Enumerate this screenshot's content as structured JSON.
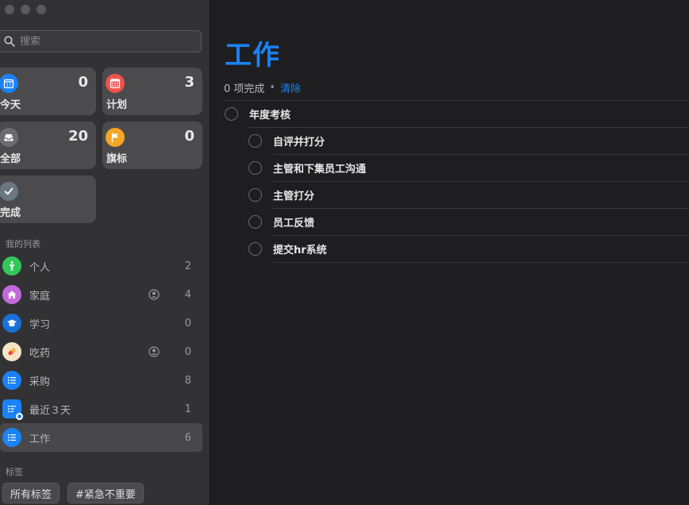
{
  "window": {
    "controls": [
      "close",
      "minimize",
      "zoom"
    ]
  },
  "sidebar": {
    "search": {
      "placeholder": "搜索"
    },
    "smart_lists": [
      {
        "id": "today",
        "label": "今天",
        "count": "0",
        "icon": "calendar-icon",
        "color": "#1a82f7"
      },
      {
        "id": "scheduled",
        "label": "计划",
        "count": "3",
        "icon": "calendar-grid-icon",
        "color": "#f0524c"
      },
      {
        "id": "all",
        "label": "全部",
        "count": "20",
        "icon": "tray-icon",
        "color": "#6c6c70"
      },
      {
        "id": "flagged",
        "label": "旗标",
        "count": "0",
        "icon": "flag-icon",
        "color": "#f5a623"
      },
      {
        "id": "completed",
        "label": "完成",
        "count": "",
        "icon": "checkmark-icon",
        "color": "#6c7780"
      }
    ],
    "my_lists_label": "我的列表",
    "lists": [
      {
        "label": "个人",
        "count": "2",
        "shared": false,
        "icon": "person-icon",
        "color": "#33c759"
      },
      {
        "label": "家庭",
        "count": "4",
        "shared": true,
        "icon": "house-icon",
        "color": "#c26adb"
      },
      {
        "label": "学习",
        "count": "0",
        "shared": false,
        "icon": "graduation-cap-icon",
        "color": "#1a6fd8"
      },
      {
        "label": "吃药",
        "count": "0",
        "shared": true,
        "icon": "pill-icon",
        "color": "#f6e4c6"
      },
      {
        "label": "采购",
        "count": "8",
        "shared": false,
        "icon": "list-icon",
        "color": "#1a82f7"
      },
      {
        "label": "最近３天",
        "count": "1",
        "shared": false,
        "icon": "smart-list-icon",
        "color": "#1a82f7"
      },
      {
        "label": "工作",
        "count": "6",
        "shared": false,
        "icon": "list-icon",
        "color": "#1a82f7",
        "selected": true
      }
    ],
    "tags_label": "标签",
    "tags": [
      "所有标签",
      "#紧急不重要"
    ]
  },
  "main": {
    "title": "工作",
    "completed_text": "0 项完成",
    "separator": "•",
    "clear_label": "清除",
    "tasks": [
      {
        "text": "年度考核",
        "level": 0
      },
      {
        "text": "自评并打分",
        "level": 1
      },
      {
        "text": "主管和下集员工沟通",
        "level": 1
      },
      {
        "text": "主管打分",
        "level": 1
      },
      {
        "text": "员工反馈",
        "level": 1
      },
      {
        "text": "提交hr系统",
        "level": 1
      }
    ]
  }
}
